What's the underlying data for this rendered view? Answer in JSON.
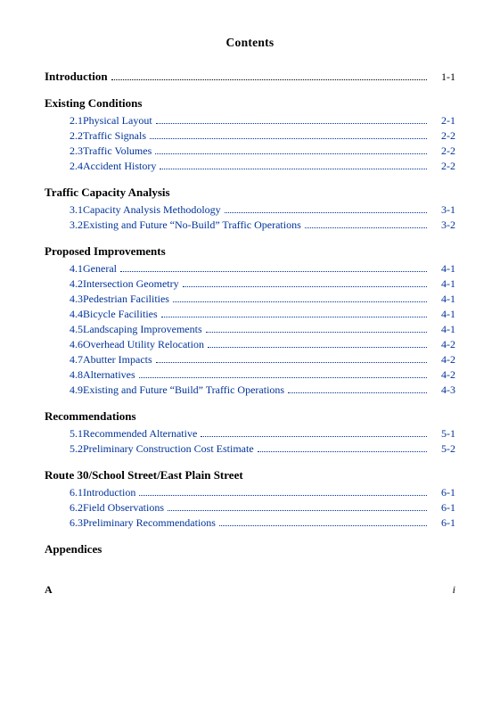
{
  "title": "Contents",
  "introduction": {
    "label": "Introduction",
    "page": "1-1"
  },
  "sections": [
    {
      "heading": "Existing Conditions",
      "entries": [
        {
          "number": "2.1",
          "label": "Physical Layout",
          "page": "2-1"
        },
        {
          "number": "2.2",
          "label": "Traffic Signals",
          "page": "2-2"
        },
        {
          "number": "2.3",
          "label": "Traffic Volumes",
          "page": "2-2"
        },
        {
          "number": "2.4",
          "label": "Accident History",
          "page": "2-2"
        }
      ]
    },
    {
      "heading": "Traffic Capacity Analysis",
      "entries": [
        {
          "number": "3.1",
          "label": "Capacity Analysis Methodology",
          "page": "3-1"
        },
        {
          "number": "3.2",
          "label": "Existing and Future “No-Build” Traffic Operations",
          "page": "3-2"
        }
      ]
    },
    {
      "heading": "Proposed Improvements",
      "entries": [
        {
          "number": "4.1",
          "label": "General",
          "page": "4-1"
        },
        {
          "number": "4.2",
          "label": "Intersection Geometry",
          "page": "4-1"
        },
        {
          "number": "4.3",
          "label": "Pedestrian Facilities",
          "page": "4-1"
        },
        {
          "number": "4.4",
          "label": "Bicycle Facilities",
          "page": "4-1"
        },
        {
          "number": "4.5",
          "label": "Landscaping Improvements",
          "page": "4-1"
        },
        {
          "number": "4.6",
          "label": "Overhead Utility Relocation",
          "page": "4-2"
        },
        {
          "number": "4.7",
          "label": "Abutter Impacts",
          "page": "4-2"
        },
        {
          "number": "4.8",
          "label": "Alternatives",
          "page": "4-2"
        },
        {
          "number": "4.9",
          "label": "Existing and Future “Build” Traffic Operations",
          "page": "4-3"
        }
      ]
    },
    {
      "heading": "Recommendations",
      "entries": [
        {
          "number": "5.1",
          "label": "Recommended Alternative",
          "page": "5-1"
        },
        {
          "number": "5.2",
          "label": "Preliminary Construction Cost Estimate",
          "page": "5-2"
        }
      ]
    },
    {
      "heading": "Route 30/School Street/East Plain Street",
      "entries": [
        {
          "number": "6.1",
          "label": "Introduction",
          "page": "6-1"
        },
        {
          "number": "6.2",
          "label": "Field Observations",
          "page": "6-1"
        },
        {
          "number": "6.3",
          "label": "Preliminary Recommendations",
          "page": "6-1"
        }
      ]
    },
    {
      "heading": "Appendices",
      "entries": []
    }
  ],
  "footer": {
    "left": "A",
    "right": "i"
  }
}
